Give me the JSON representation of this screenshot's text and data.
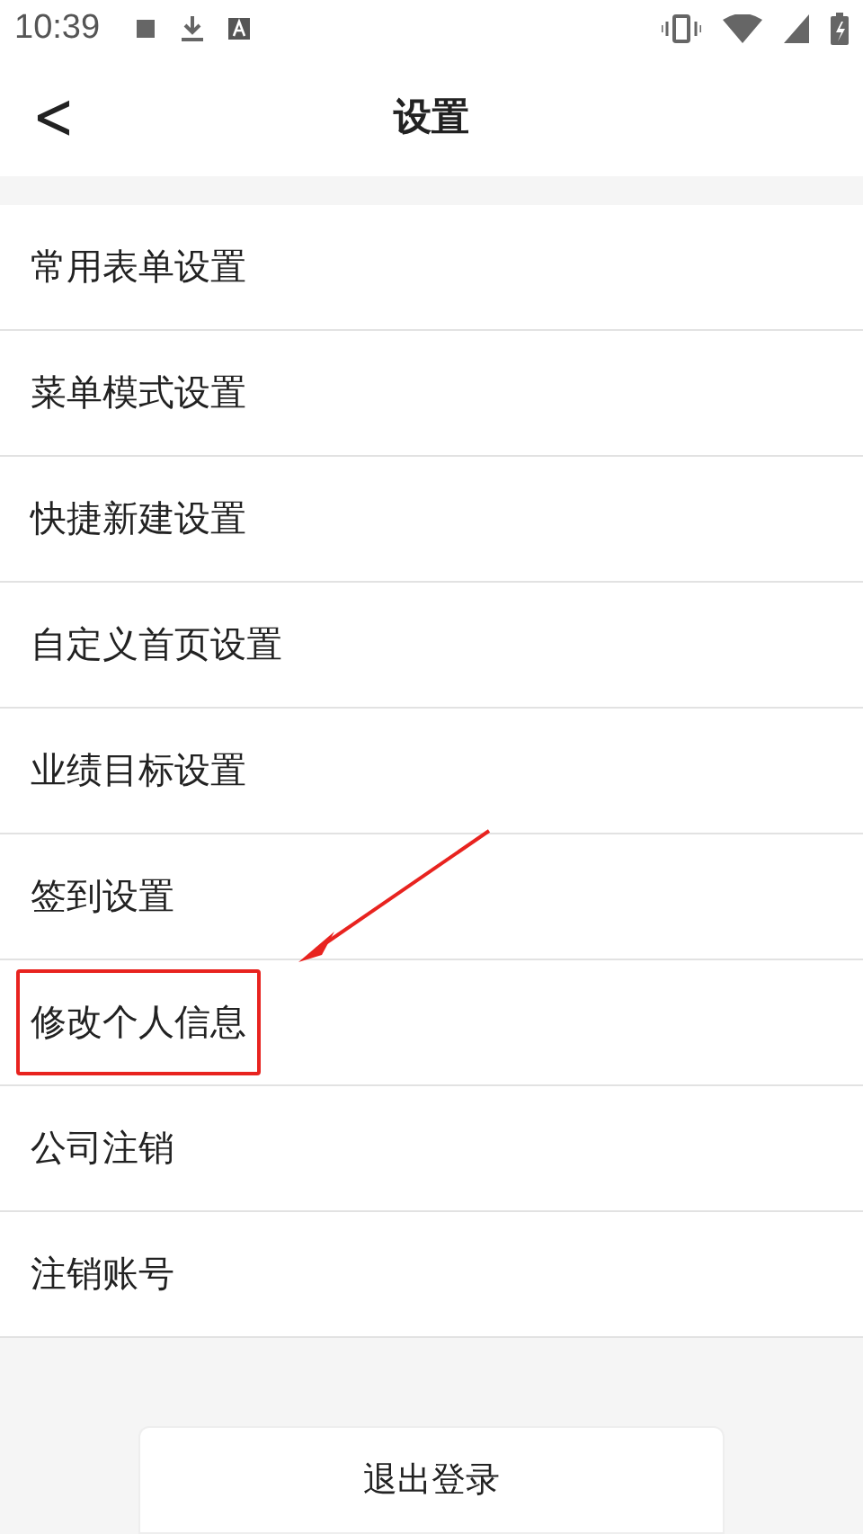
{
  "status_bar": {
    "time": "10:39"
  },
  "header": {
    "back": "<",
    "title": "设置"
  },
  "items": [
    {
      "label": "常用表单设置",
      "highlighted": false
    },
    {
      "label": "菜单模式设置",
      "highlighted": false
    },
    {
      "label": "快捷新建设置",
      "highlighted": false
    },
    {
      "label": "自定义首页设置",
      "highlighted": false
    },
    {
      "label": "业绩目标设置",
      "highlighted": false
    },
    {
      "label": "签到设置",
      "highlighted": false
    },
    {
      "label": "修改个人信息",
      "highlighted": true
    },
    {
      "label": "公司注销",
      "highlighted": false
    },
    {
      "label": "注销账号",
      "highlighted": false
    }
  ],
  "logout_button": "退出登录"
}
